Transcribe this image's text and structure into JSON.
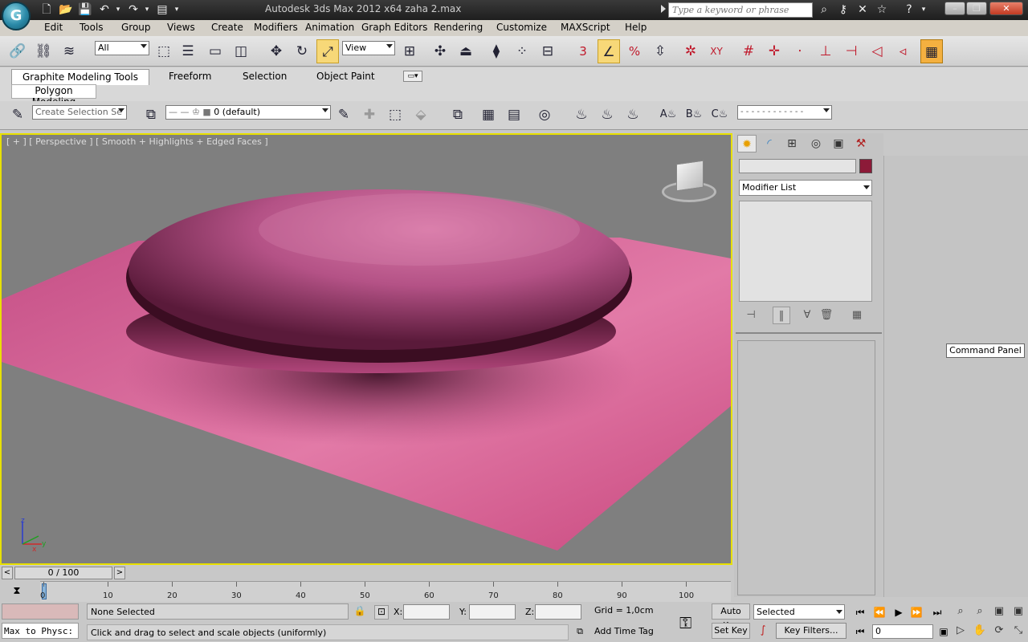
{
  "window": {
    "title": "Autodesk 3ds Max  2012 x64      zaha 2.max",
    "search_placeholder": "Type a keyword or phrase"
  },
  "menu": [
    "Edit",
    "Tools",
    "Group",
    "Views",
    "Create",
    "Modifiers",
    "Animation",
    "Graph Editors",
    "Rendering",
    "Customize",
    "MAXScript",
    "Help"
  ],
  "toolbar": {
    "selection_filter": "All",
    "reference_coord": "View",
    "snaps_label": "3",
    "angle_label": "%"
  },
  "ribbon": {
    "tabs": [
      "Graphite Modeling Tools",
      "Freeform",
      "Selection",
      "Object Paint"
    ],
    "active_tab": "Graphite Modeling Tools",
    "subtab": "Polygon Modeling",
    "named_selection_placeholder": "Create Selection Se",
    "layer": "0 (default)"
  },
  "viewport": {
    "label": "[ + ] [ Perspective ] [ Smooth + Highlights + Edged Faces ]",
    "axis_z": "z",
    "axis_x": "x",
    "axis_y": "y"
  },
  "command_panel": {
    "modifier_list": "Modifier List",
    "swatch_color": "#8c1a38",
    "tooltip": "Command Panel"
  },
  "timeslider": {
    "position": "0 / 100",
    "left": "<",
    "right": ">",
    "ticks": [
      "0",
      "10",
      "20",
      "30",
      "40",
      "50",
      "60",
      "70",
      "80",
      "90",
      "100"
    ]
  },
  "status": {
    "maxscript_input": "Max to Physc:",
    "selection_info": "None Selected",
    "prompt": "Click and drag to select and scale objects (uniformly)",
    "x_label": "X:",
    "y_label": "Y:",
    "z_label": "Z:",
    "grid": "Grid = 1,0cm",
    "add_time_tag": "Add Time Tag",
    "auto_key": "Auto Key",
    "set_key": "Set Key",
    "key_mode": "Selected",
    "key_filters": "Key Filters...",
    "frame": "0"
  }
}
